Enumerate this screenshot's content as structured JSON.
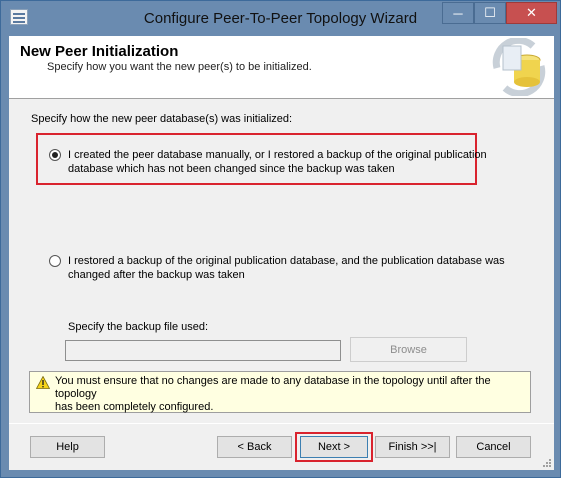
{
  "window": {
    "title": "Configure Peer-To-Peer Topology Wizard",
    "minimize_glyph": "─",
    "maximize_glyph": "☐",
    "close_glyph": "✕"
  },
  "header": {
    "title": "New Peer Initialization",
    "subtitle": "Specify how you want the new peer(s) to be initialized."
  },
  "main": {
    "prompt": "Specify how the new peer database(s) was initialized:",
    "option1": {
      "line1": "I created the peer database manually, or I restored a backup of the original publication",
      "line2": "database which has not been changed since the backup was taken",
      "selected": true
    },
    "option2": {
      "line1": "I restored a backup of the original publication database, and the publication database was",
      "line2": "changed after the backup was taken",
      "selected": false
    },
    "backup_label": "Specify the backup file used:",
    "backup_value": "",
    "browse_label": "Browse"
  },
  "warning": {
    "line1": "You must ensure that no changes are made to any database in the topology until after the topology",
    "line2": "has been completely configured."
  },
  "buttons": {
    "help": "Help",
    "back": "< Back",
    "next": "Next >",
    "finish": "Finish >>|",
    "cancel": "Cancel"
  },
  "colors": {
    "highlight": "#d9232e",
    "title_bar": "#6a8bb0",
    "close": "#c75050",
    "warning_bg": "#ffffe1"
  }
}
